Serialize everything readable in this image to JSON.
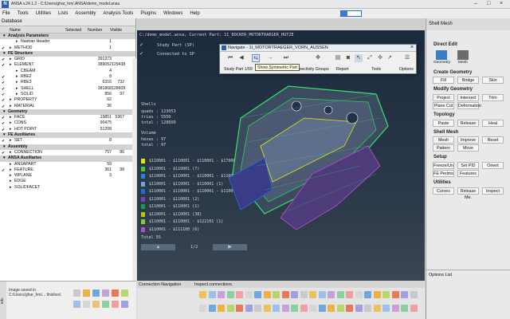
{
  "app": {
    "title": "ANSA v.24.1.2 - C:/Users/ghar_hm/.ANSA/demo_model.ansa",
    "menu": [
      "File",
      "Tools",
      "Utilities",
      "Lists",
      "Assembly",
      "Analysis Tools",
      "Plugins",
      "Windows",
      "Help"
    ]
  },
  "database": {
    "title": "Database",
    "columns": {
      "name": "Name",
      "selected": "Selected",
      "number": "Number",
      "visible": "Visible"
    },
    "rows": [
      {
        "name": "Analysis Parameters",
        "level": 0,
        "group": true
      },
      {
        "name": "Nastran Header",
        "level": 2,
        "number": "1"
      },
      {
        "name": "METHOD",
        "level": 1,
        "check": true,
        "number": "1"
      },
      {
        "name": "FE Structure",
        "level": 0,
        "group": true
      },
      {
        "name": "GRID",
        "level": 1,
        "check": true,
        "number": "391373"
      },
      {
        "name": "ELEMENT",
        "level": 1,
        "check": true,
        "number": "389052",
        "visible": "129438"
      },
      {
        "name": "CBEAM",
        "level": 2,
        "number": "4"
      },
      {
        "name": "RBE2",
        "level": 2,
        "check": true,
        "number": "8"
      },
      {
        "name": "RBE3",
        "level": 2,
        "check": true,
        "number": "6316",
        "visible": "732"
      },
      {
        "name": "SHELL",
        "level": 2,
        "check": true,
        "number": "381868",
        "visible": "128609"
      },
      {
        "name": "SOLID",
        "level": 2,
        "check": true,
        "number": "856",
        "visible": "97"
      },
      {
        "name": "PROPERTY",
        "level": 1,
        "check": true,
        "number": "62"
      },
      {
        "name": "MATERIAL",
        "level": 1,
        "check": true,
        "number": "36"
      },
      {
        "name": "Geometry",
        "level": 0,
        "group": true
      },
      {
        "name": "FACE",
        "level": 1,
        "check": true,
        "number": "19851",
        "visible": "5367"
      },
      {
        "name": "CONS",
        "level": 1,
        "check": true,
        "number": "90475"
      },
      {
        "name": "HOT POINT",
        "level": 1,
        "check": true,
        "number": "51208"
      },
      {
        "name": "FE Auxiliaries",
        "level": 0,
        "group": true
      },
      {
        "name": "SET",
        "level": 1,
        "check": true,
        "number": "8"
      },
      {
        "name": "Assembly",
        "level": 0,
        "group": true
      },
      {
        "name": "CONNECTION",
        "level": 1,
        "check": true,
        "number": "757",
        "visible": "86"
      },
      {
        "name": "ANSA Auxiliaries",
        "level": 0,
        "group": true
      },
      {
        "name": "ANSAPART",
        "level": 1,
        "number": "59"
      },
      {
        "name": "FEATURE",
        "level": 1,
        "check": true,
        "number": "361",
        "visible": "98"
      },
      {
        "name": "WPLANE",
        "level": 1,
        "number": "3"
      },
      {
        "name": "EDGE",
        "level": 1
      },
      {
        "name": "SOLIDFACET",
        "level": 1
      }
    ]
  },
  "viewport": {
    "header": "C:/demo_model.ansa,  Current Part: 1I_BOCKER_MOTORTRAEGER_HUTZE",
    "checks": [
      "Study Part (SP)",
      "Connected to SP"
    ],
    "shells_label": "Shells",
    "stats": [
      "quads : 123053",
      "trias :   5550",
      "total :  128609"
    ],
    "volume_label": "Volume",
    "volume_stats": [
      "hexas :      97",
      "total :      97"
    ],
    "legend": [
      {
        "color": "#e6e600",
        "text": "$110001 - $110001 - $110001 - $170001 (1)"
      },
      {
        "color": "#3cc83c",
        "text": "$110001 - $110001 (7)"
      },
      {
        "color": "#2f7fd6",
        "text": "$110001 - $110001 - $110001 - $110001 (1)"
      },
      {
        "color": "#6aa9e6",
        "text": "$110001 - $110001 - $110001 (1)"
      },
      {
        "color": "#2a6ad0",
        "text": "$110001 - $110001 - $110001 - $110001 (1)"
      },
      {
        "color": "#7d3fb0",
        "text": "$110001 - $110001 (2)"
      },
      {
        "color": "#1a9a50",
        "text": "$110001 - $110001 (1)"
      },
      {
        "color": "#c0c000",
        "text": "$110001 - $110001 (38)"
      },
      {
        "color": "#8ac83c",
        "text": "$110001 - $110001 - $122101 (1)"
      },
      {
        "color": "#b04fc8",
        "text": "$110001 - $111100 (6)"
      }
    ],
    "total": "Total 55",
    "pager": "1/2"
  },
  "navigate": {
    "title": "Navigate - 1I_MOTORTRAEGER_VORN_AUSSEN",
    "close": "×",
    "sections": [
      "Study Part 1/59",
      "Connectivity Groups",
      "Report",
      "Tools",
      "Options"
    ],
    "tooltip": "Show Symmetric Part"
  },
  "shellmesh": {
    "title": "Shell Mesh",
    "sections": [
      {
        "title": "Direct Edit",
        "buttons": [
          "Geometry",
          "Mesh"
        ]
      },
      {
        "title": "Create Geometry",
        "buttons": [
          "Fill",
          "Bridge",
          "Skin"
        ]
      },
      {
        "title": "Modify Geometry",
        "buttons": [
          "Project",
          "Intersect",
          "Trim",
          "Plane Cut",
          "Deformation"
        ]
      },
      {
        "title": "Topology",
        "buttons": [
          "Paste",
          "Release",
          "Heal"
        ]
      },
      {
        "title": "Shell Mesh",
        "buttons": [
          "Mesh",
          "Improve",
          "Reset",
          "Pattern",
          "Move"
        ]
      },
      {
        "title": "Setup",
        "buttons": [
          "Freeze/Un",
          "Set PID",
          "Orient",
          "FE Perims",
          "Features"
        ]
      },
      {
        "title": "Utilities",
        "buttons": [
          "Curves",
          "Release Me.",
          "Inspect"
        ]
      }
    ],
    "options_list": "Options List"
  },
  "bottom": {
    "connection_nav": "Connection Navigation",
    "inspect_msg": "Inspect connections.",
    "info_tab": "Info",
    "info_msg": "Image saved in C:/Users/ghar_hm/... finished."
  }
}
